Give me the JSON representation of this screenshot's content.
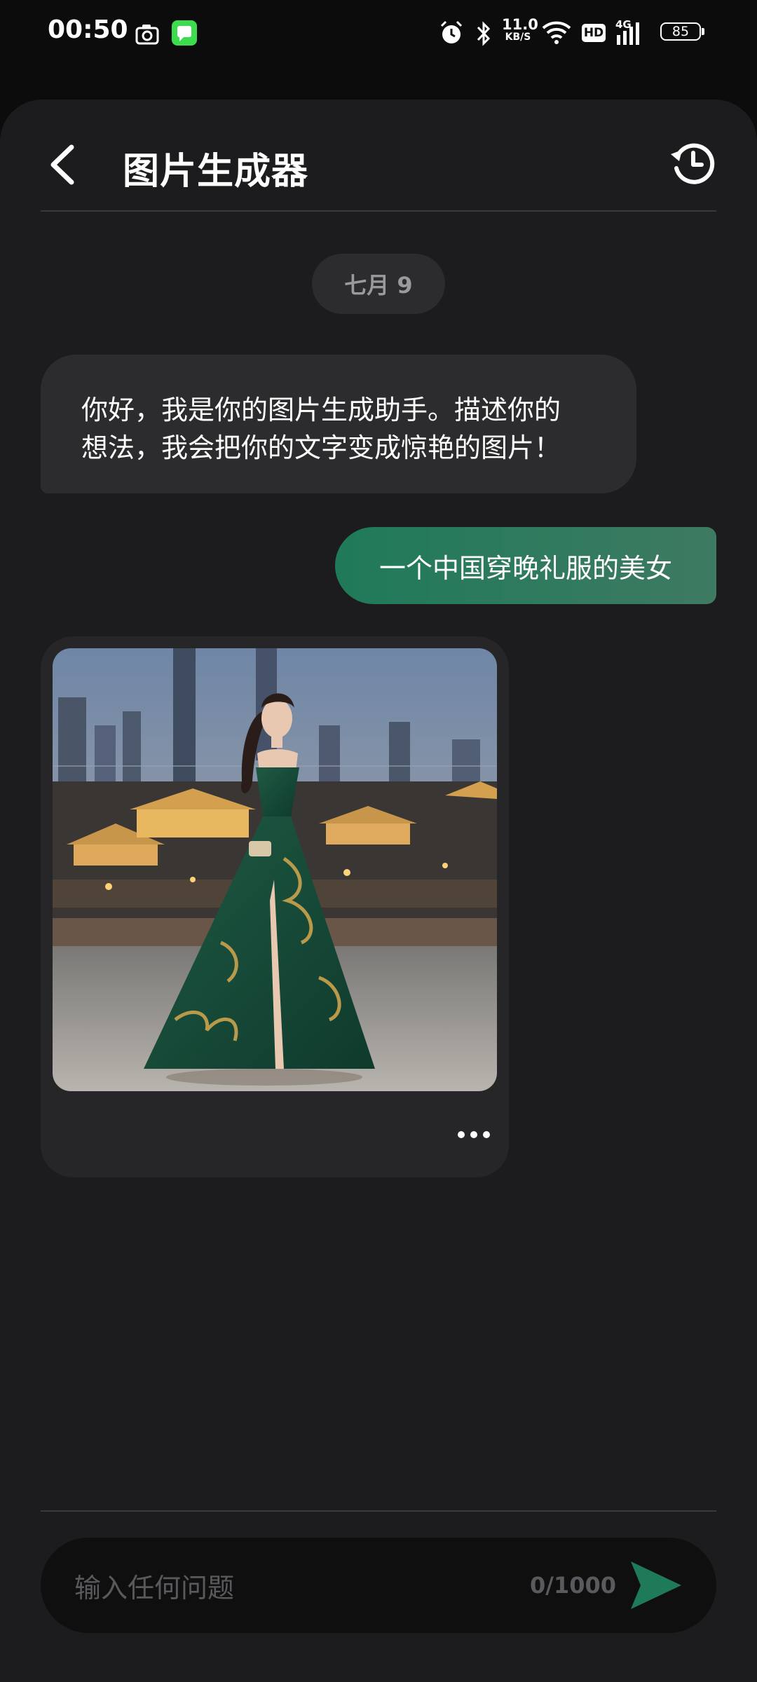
{
  "status_bar": {
    "time": "00:50",
    "net_speed_value": "11.0",
    "net_speed_unit": "KB/S",
    "hd_label": "HD",
    "signal_label": "4G",
    "battery": "85"
  },
  "header": {
    "title": "图片生成器"
  },
  "chat": {
    "date_label": "七月 9",
    "bot_greeting_line1": "你好，我是你的图片生成助手。描述你的",
    "bot_greeting_line2": "想法，我会把你的文字变成惊艳的图片！",
    "user_prompt": "一个中国穿晚礼服的美女"
  },
  "input": {
    "placeholder": "输入任何问题",
    "char_count": "0/1000"
  },
  "colors": {
    "accent_green": "#1f7a5a",
    "sheet_bg": "#1c1c1e",
    "bubble_bg": "#2c2c2e"
  }
}
